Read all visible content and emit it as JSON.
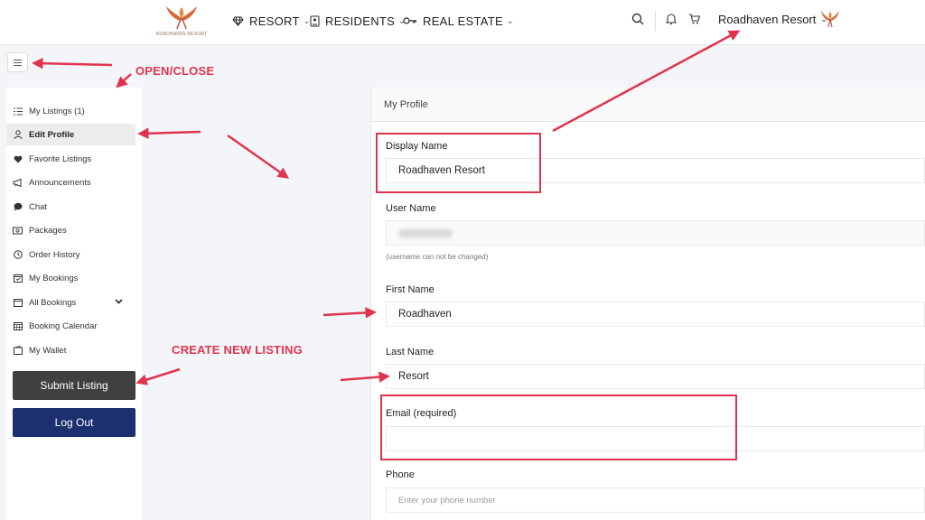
{
  "logo": {
    "text": "ROADHAVEN RESORT"
  },
  "nav": [
    {
      "label": "RESORT",
      "icon": "diamond-icon"
    },
    {
      "label": "RESIDENTS",
      "icon": "id-card-icon"
    },
    {
      "label": "REAL ESTATE",
      "icon": "key-icon"
    }
  ],
  "account": {
    "name": "Roadhaven Resort"
  },
  "sidebar": {
    "items": [
      {
        "label": "My Listings (1)",
        "icon": "list-icon"
      },
      {
        "label": "Edit Profile",
        "icon": "user-icon"
      },
      {
        "label": "Favorite Listings",
        "icon": "heart-icon"
      },
      {
        "label": "Announcements",
        "icon": "megaphone-icon"
      },
      {
        "label": "Chat",
        "icon": "chat-bubble-icon"
      },
      {
        "label": "Packages",
        "icon": "package-icon"
      },
      {
        "label": "Order History",
        "icon": "clock-icon"
      },
      {
        "label": "My Bookings",
        "icon": "calendar-check-icon"
      },
      {
        "label": "All Bookings",
        "icon": "calendar-icon"
      },
      {
        "label": "Booking Calendar",
        "icon": "calendar-grid-icon"
      },
      {
        "label": "My Wallet",
        "icon": "wallet-icon"
      }
    ],
    "submit_label": "Submit Listing",
    "logout_label": "Log Out"
  },
  "profile": {
    "title": "My Profile",
    "display_name": {
      "label": "Display Name",
      "value": "Roadhaven Resort"
    },
    "user_name": {
      "label": "User Name",
      "hint": "(username can not be changed)"
    },
    "first_name": {
      "label": "First Name",
      "value": "Roadhaven"
    },
    "last_name": {
      "label": "Last Name",
      "value": "Resort"
    },
    "email": {
      "label": "Email (required)",
      "value": ""
    },
    "phone": {
      "label": "Phone",
      "placeholder": "Enter your phone number"
    }
  },
  "annotations": {
    "open_close": "OPEN/CLOSE",
    "create_listing": "CREATE NEW LISTING"
  },
  "colors": {
    "annotation": "#e0344e",
    "logout_bg": "#1c2f6e",
    "submit_bg": "#404040"
  }
}
